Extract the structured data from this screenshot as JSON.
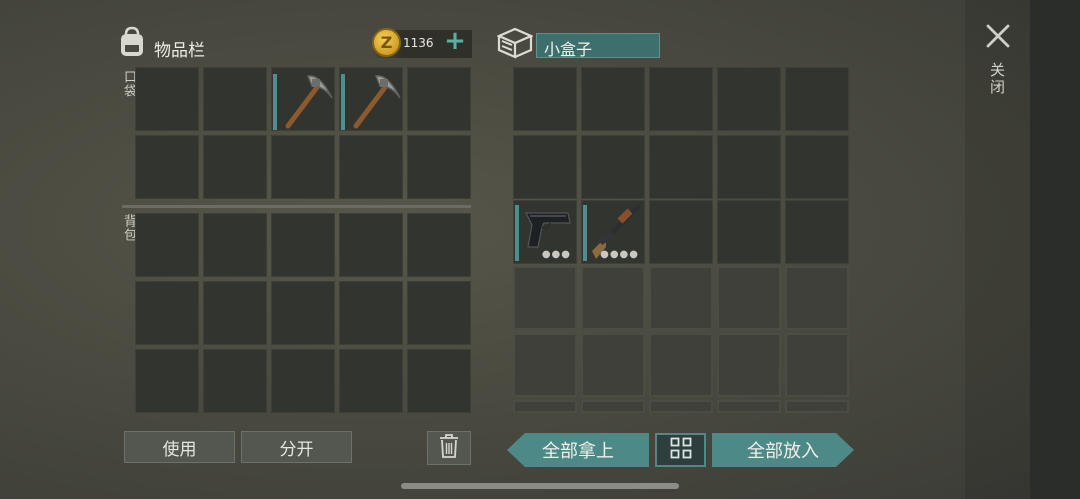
{
  "inventory": {
    "title": "物品栏",
    "coins": "1136",
    "pocket_label": "口袋",
    "backpack_label": "背包"
  },
  "container": {
    "name": "小盒子"
  },
  "close": {
    "label": "关闭"
  },
  "buttons": {
    "use": "使用",
    "split": "分开",
    "take_all": "全部拿上",
    "put_all": "全部放入"
  },
  "items": {
    "pocket": [
      "pickaxe",
      "pickaxe"
    ],
    "container": [
      "pistol",
      "shotgun"
    ]
  },
  "colors": {
    "accent_teal": "#4d8a87",
    "coin_gold": "#d7a623",
    "slot_dark": "#32342f"
  }
}
